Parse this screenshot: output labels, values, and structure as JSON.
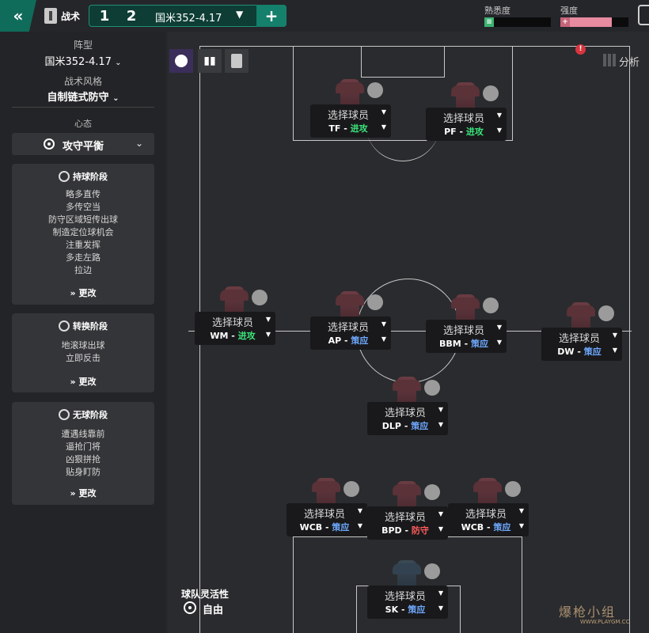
{
  "topbar": {
    "back_icon": "double-chevron-left-icon",
    "tactics_label": "战术",
    "tab1": "1",
    "tab2": "2",
    "tactic_name": "国米352-4.17",
    "add_label": "+",
    "familiarity_label": "熟悉度",
    "familiarity_level": 0.1,
    "intensity_label": "强度",
    "intensity_level": 0.75,
    "colors": {
      "accent": "#15806b",
      "familiarity": "#3cb371",
      "intensity": "#e88aa0"
    }
  },
  "left": {
    "formation_label": "阵型",
    "formation_value": "国米352-4.17",
    "style_label": "战术风格",
    "style_value": "自制链式防守",
    "mentality_label": "心态",
    "mentality_value": "攻守平衡",
    "in_possession": {
      "title": "持球阶段",
      "items": [
        "略多直传",
        "多传空当",
        "防守区域短传出球",
        "制造定位球机会",
        "注重发挥",
        "多走左路",
        "拉边"
      ],
      "more": "更改"
    },
    "transition": {
      "title": "转换阶段",
      "items": [
        "地滚球出球",
        "立即反击"
      ],
      "more": "更改"
    },
    "out_of_possession": {
      "title": "无球阶段",
      "items": [
        "遭遇线靠前",
        "逼抢门将",
        "凶狠拼抢",
        "贴身盯防"
      ],
      "more": "更改"
    }
  },
  "pitch": {
    "analysis_label": "分析",
    "pick_label": "选择球员",
    "players": [
      {
        "role": "TF",
        "duty": "进攻",
        "type": "attack"
      },
      {
        "role": "PF",
        "duty": "进攻",
        "type": "attack"
      },
      {
        "role": "WM",
        "duty": "进攻",
        "type": "attack"
      },
      {
        "role": "AP",
        "duty": "策应",
        "type": "support"
      },
      {
        "role": "BBM",
        "duty": "策应",
        "type": "support"
      },
      {
        "role": "DW",
        "duty": "策应",
        "type": "support"
      },
      {
        "role": "DLP",
        "duty": "策应",
        "type": "support"
      },
      {
        "role": "WCB",
        "duty": "策应",
        "type": "support"
      },
      {
        "role": "BPD",
        "duty": "防守",
        "type": "defend"
      },
      {
        "role": "WCB",
        "duty": "策应",
        "type": "support"
      },
      {
        "role": "SK",
        "duty": "策应",
        "type": "support"
      }
    ],
    "fluidity_label": "球队灵活性",
    "fluidity_value": "自由"
  },
  "watermark": {
    "text": "爆枪小组",
    "url": "WWW.PLAYGM.CC"
  }
}
